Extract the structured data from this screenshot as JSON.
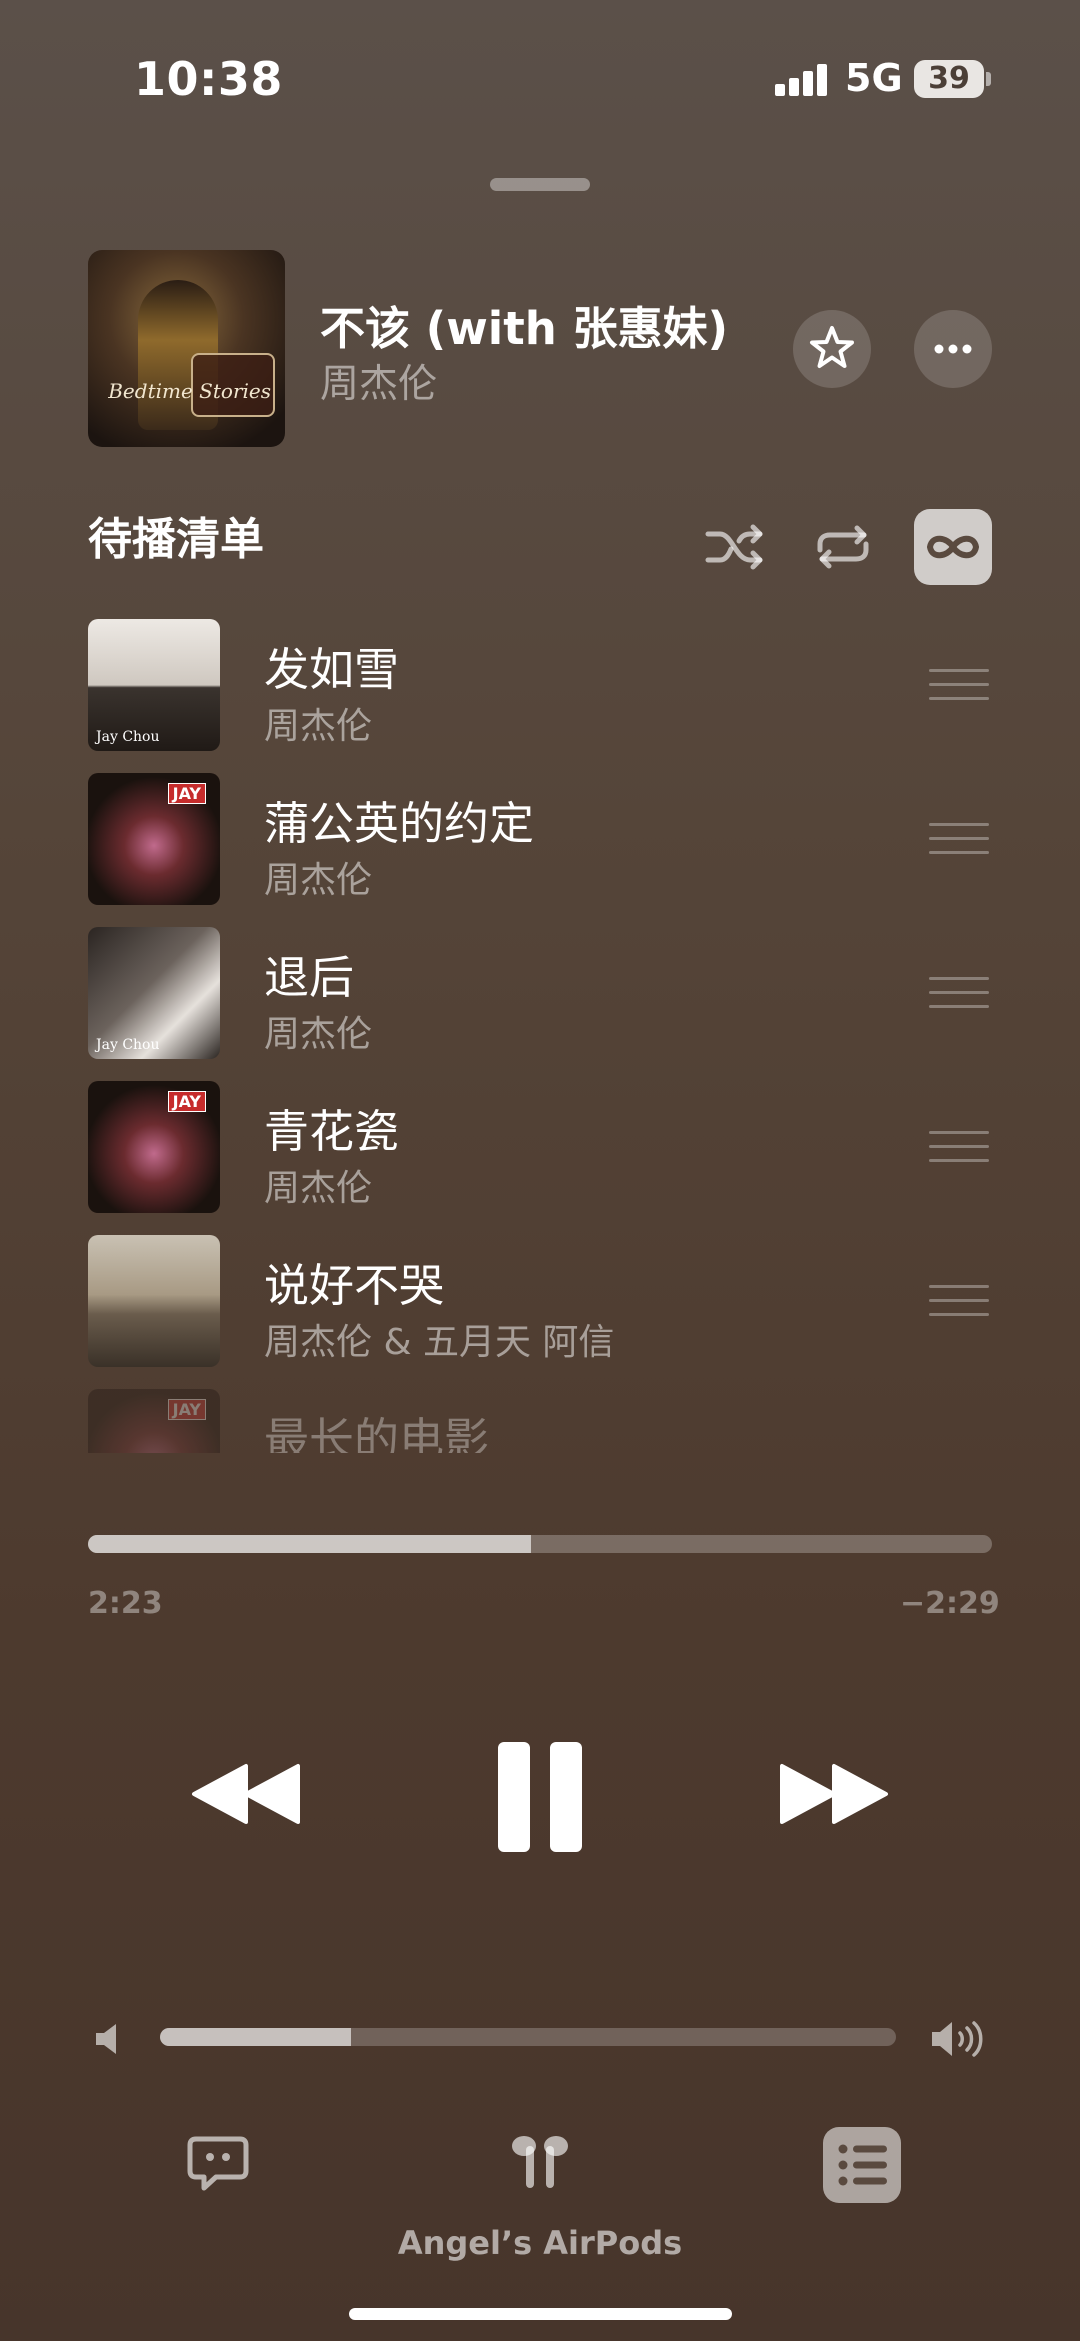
{
  "status_bar": {
    "time": "10:38",
    "network": "5G",
    "battery": "39"
  },
  "now_playing": {
    "title": "不该 (with 张惠妹)",
    "artist": "周杰伦",
    "art_text": "Bedtime Stories",
    "favorite_icon": "star-icon",
    "more_icon": "ellipsis-icon"
  },
  "queue": {
    "title": "待播清单",
    "controls": {
      "shuffle_icon": "shuffle-icon",
      "repeat_icon": "repeat-icon",
      "autoplay_icon": "infinity-icon",
      "autoplay_on": true
    },
    "items": [
      {
        "title": "发如雪",
        "artist": "周杰伦",
        "art_text": "Jay Chou"
      },
      {
        "title": "蒲公英的约定",
        "artist": "周杰伦",
        "art_text": "JAY"
      },
      {
        "title": "退后",
        "artist": "周杰伦",
        "art_text": "Jay Chou"
      },
      {
        "title": "青花瓷",
        "artist": "周杰伦",
        "art_text": "JAY"
      },
      {
        "title": "说好不哭",
        "artist": "周杰伦 & 五月天 阿信",
        "art_text": ""
      },
      {
        "title": "最长的电影",
        "artist": "",
        "art_text": "JAY"
      }
    ]
  },
  "playback": {
    "elapsed": "2:23",
    "remaining": "−2:29",
    "progress_fraction": 0.49
  },
  "volume": {
    "level_fraction": 0.26
  },
  "bottom_bar": {
    "lyrics_icon": "lyrics-quote-icon",
    "airplay_icon": "airpods-icon",
    "route_label": "Angel’s AirPods",
    "queue_icon": "list-icon"
  },
  "colors": {
    "background": "#554539",
    "accent": "#ffffff"
  }
}
